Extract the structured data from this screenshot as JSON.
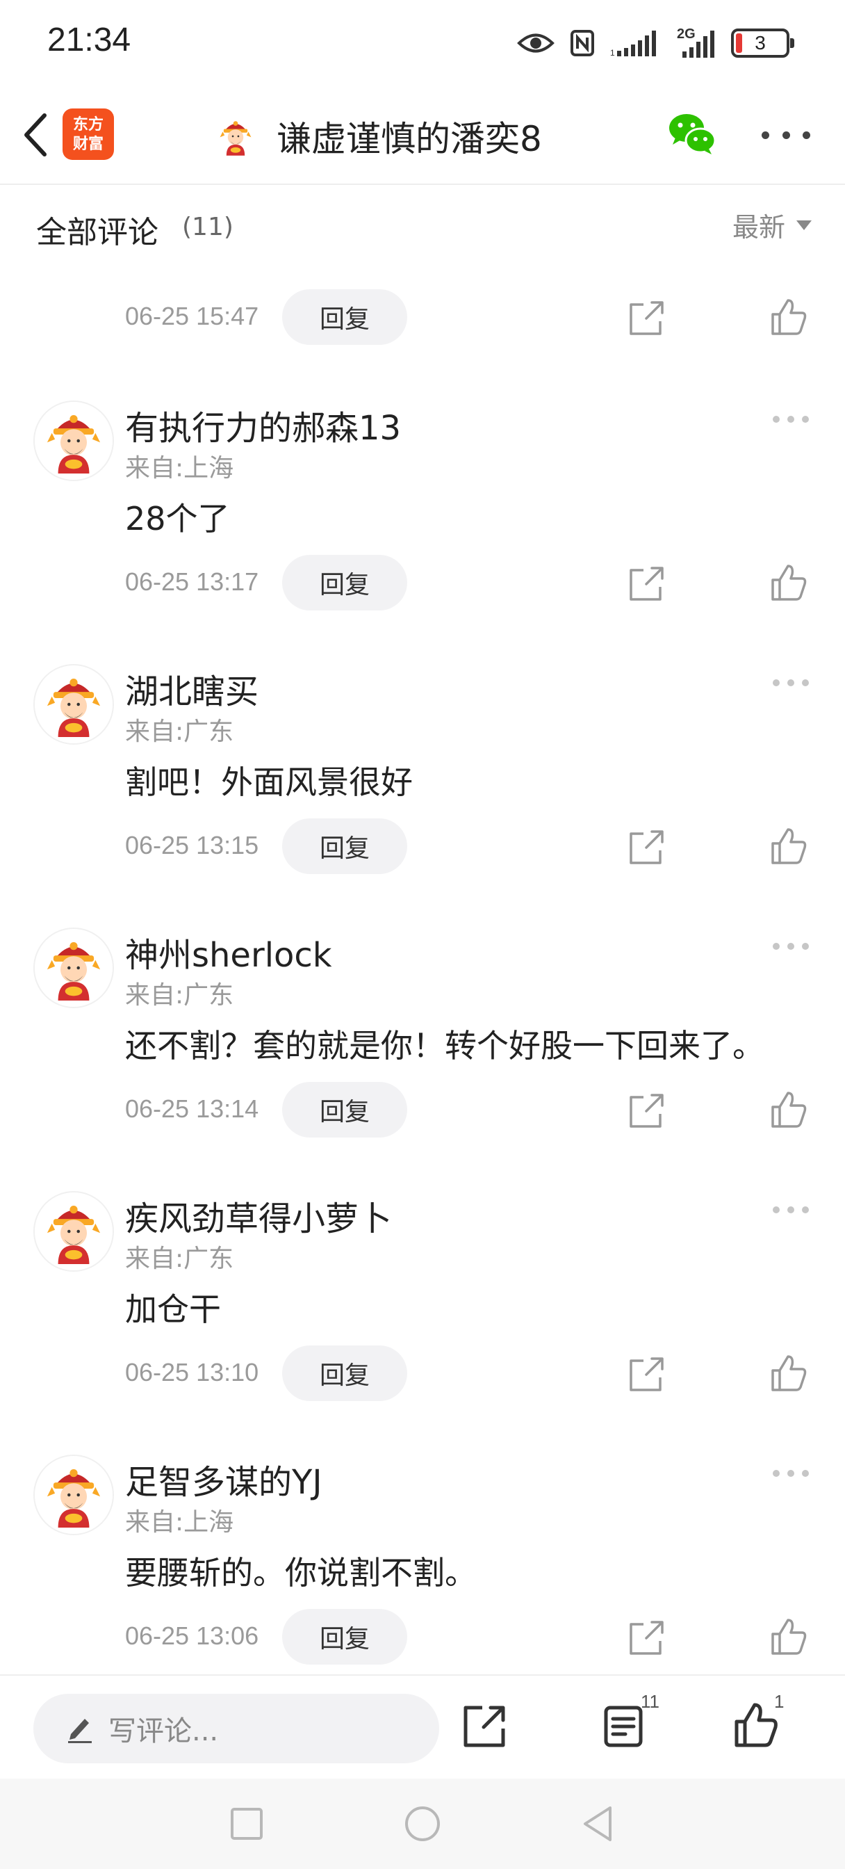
{
  "status_bar": {
    "time": "21:34",
    "network_label": "2G",
    "battery_level": "3",
    "icons": [
      "eye-icon",
      "nfc-icon",
      "signal-icon",
      "signal-2g-icon",
      "battery-icon"
    ]
  },
  "header": {
    "logo_line1": "东方",
    "logo_line2": "财富",
    "title": "谦虚谨慎的潘奕8",
    "icons": [
      "back-arrow-icon",
      "wechat-icon",
      "more-dots-icon"
    ]
  },
  "comments_section": {
    "title": "全部评论",
    "count": "(11)",
    "sort_label": "最新"
  },
  "first_comment_tail": {
    "time": "06-25 15:47",
    "reply_label": "回复"
  },
  "comments": [
    {
      "username": "有执行力的郝森13",
      "location": "来自:上海",
      "content": "28个了",
      "time": "06-25 13:17",
      "reply_label": "回复"
    },
    {
      "username": "湖北瞎买",
      "location": "来自:广东",
      "content": "割吧！外面风景很好",
      "time": "06-25 13:15",
      "reply_label": "回复"
    },
    {
      "username": "神州sherlock",
      "location": "来自:广东",
      "content": "还不割？套的就是你！转个好股一下回来了。",
      "time": "06-25 13:14",
      "reply_label": "回复"
    },
    {
      "username": "疾风劲草得小萝卜",
      "location": "来自:广东",
      "content": "加仓干",
      "time": "06-25 13:10",
      "reply_label": "回复"
    },
    {
      "username": "足智多谋的YJ",
      "location": "来自:上海",
      "content": "要腰斩的。你说割不割。",
      "time": "06-25 13:06",
      "reply_label": "回复"
    }
  ],
  "bottom_bar": {
    "input_placeholder": "写评论...",
    "comment_count": "11",
    "like_count": "1"
  },
  "colors": {
    "brand_orange": "#f4511e",
    "wechat_green": "#2dc100",
    "battery_low_red": "#e53935",
    "meta_gray": "#9a9a9a",
    "pill_bg": "#f2f2f4"
  }
}
